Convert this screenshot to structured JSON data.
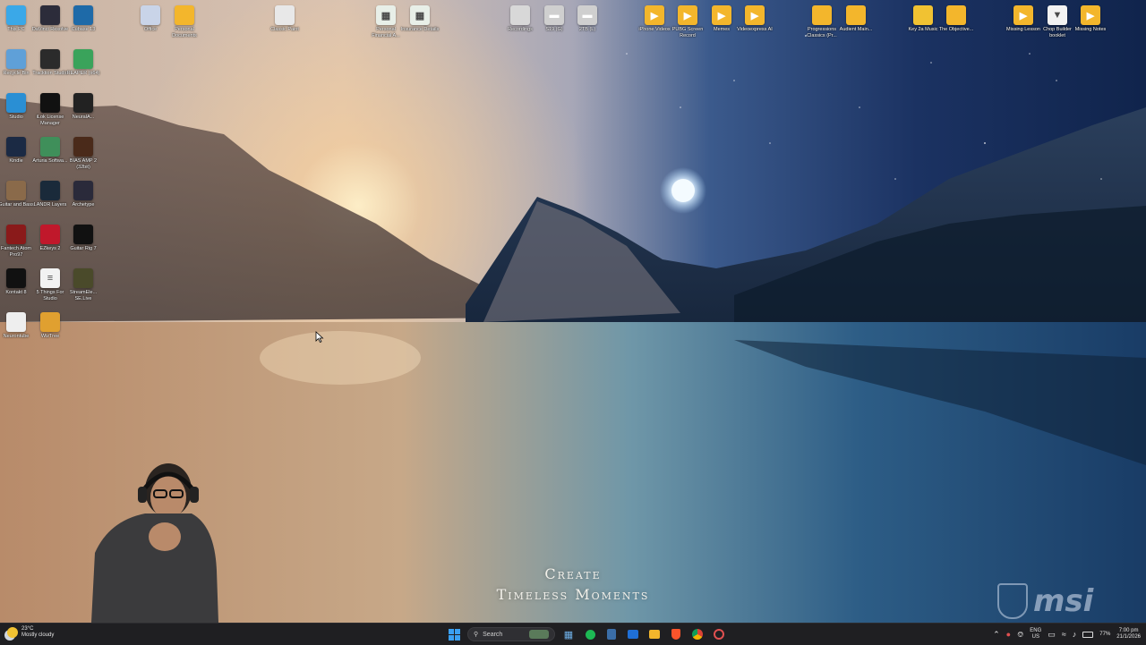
{
  "desktop_icons": [
    {
      "label": "This PC",
      "icon": "pc-icon",
      "color": "#3aa8e8"
    },
    {
      "label": "DaVinci Resolve",
      "icon": "davinci-icon",
      "color": "#2c2c3a"
    },
    {
      "label": "Cubase 13",
      "icon": "cubase-icon",
      "color": "#1e6aa8"
    },
    {
      "label": "Recycle Bin",
      "icon": "recycle-bin-icon",
      "color": "#5fa0d8"
    },
    {
      "label": "Tracktion Studio",
      "icon": "tracktion-icon",
      "color": "#2b2b2b"
    },
    {
      "label": "REAPER (x64)",
      "icon": "reaper-icon",
      "color": "#3aa35b"
    },
    {
      "label": "Studio",
      "icon": "studio-icon",
      "color": "#2a8fd4"
    },
    {
      "label": "iLok License Manager",
      "icon": "ilok-icon",
      "color": "#111111"
    },
    {
      "label": "NeuralA...",
      "icon": "neural-icon",
      "color": "#222222"
    },
    {
      "label": "Kindle",
      "icon": "kindle-icon",
      "color": "#1b2a44"
    },
    {
      "label": "Arturia Softwa...",
      "icon": "arturia-icon",
      "color": "#3f8f5a"
    },
    {
      "label": "BIAS AMP 2 (32bit)",
      "icon": "bias-amp-icon",
      "color": "#4a2a1a"
    },
    {
      "label": "Guitar and Bass",
      "icon": "guitar-icon",
      "color": "#8a6a4a"
    },
    {
      "label": "LANDR Layers",
      "icon": "landr-icon",
      "color": "#1a2a3a"
    },
    {
      "label": "Archetype",
      "icon": "archetype-icon",
      "color": "#2a2a3a"
    },
    {
      "label": "Fantech Atom Pro97",
      "icon": "fantech-icon",
      "color": "#8a1a1a"
    },
    {
      "label": "EZkeys 2",
      "icon": "ezkeys-icon",
      "color": "#c0182b"
    },
    {
      "label": "Guitar Rig 7",
      "icon": "guitar-rig-icon",
      "color": "#111111"
    },
    {
      "label": "Kontakt 8",
      "icon": "kontakt-icon",
      "color": "#111111"
    },
    {
      "label": "5 Things For Studio",
      "icon": "text-file-icon",
      "color": "#f2f2f2"
    },
    {
      "label": "StreamEle... SE.Live",
      "icon": "streamelements-icon",
      "color": "#4a4a2a"
    },
    {
      "label": "Neurontube",
      "icon": "neurontube-icon",
      "color": "#eeeeee"
    },
    {
      "label": "WizTree",
      "icon": "wiztree-icon",
      "color": "#e0a030"
    },
    {
      "label": "Office",
      "icon": "office-icon",
      "color": "#c9d4e8"
    },
    {
      "label": "Personal Documents",
      "icon": "folder-icon",
      "color": "#f3b62c"
    },
    {
      "label": "Classic Paint",
      "icon": "paint-icon",
      "color": "#e8e8e8"
    },
    {
      "label": "Personal Financial A...",
      "icon": "spreadsheet-icon",
      "color": "#e8efe8"
    },
    {
      "label": "Insurance Details",
      "icon": "spreadsheet-icon",
      "color": "#e8efe8"
    },
    {
      "label": "Recordings",
      "icon": "recordings-icon",
      "color": "#d8d8d8"
    },
    {
      "label": "S19 (G)",
      "icon": "drive-icon",
      "color": "#cfcfcf"
    },
    {
      "label": "2TB (L)",
      "icon": "drive-icon",
      "color": "#cfcfcf"
    },
    {
      "label": "iPhone Videos",
      "icon": "video-folder-icon",
      "color": "#f3b62c"
    },
    {
      "label": "PUBG Screen Record",
      "icon": "video-folder-icon",
      "color": "#f3b62c"
    },
    {
      "label": "Memes",
      "icon": "video-folder-icon",
      "color": "#f3b62c"
    },
    {
      "label": "Videoexpress AI",
      "icon": "video-folder-icon",
      "color": "#f3b62c"
    },
    {
      "label": "Progressions Classics (Pr...",
      "icon": "folder-icon",
      "color": "#f3b62c"
    },
    {
      "label": "Audient Main...",
      "icon": "folder-icon",
      "color": "#f3b62c"
    },
    {
      "label": "Key 2a Music",
      "icon": "chrome-icon",
      "color": "#f1c232"
    },
    {
      "label": "The Objective...",
      "icon": "folder-icon",
      "color": "#f3b62c"
    },
    {
      "label": "Missing Lesson",
      "icon": "video-folder-icon",
      "color": "#f3b62c"
    },
    {
      "label": "Chop Builder booklet",
      "icon": "pdf-icon",
      "color": "#f2f2f2"
    },
    {
      "label": "Missing Notes",
      "icon": "video-folder-icon",
      "color": "#f3b62c"
    }
  ],
  "wallpaper": {
    "tagline_line1": "Create",
    "tagline_line2": "Timeless Moments",
    "brand": "msi"
  },
  "taskbar": {
    "weather_temp": "23°C",
    "weather_desc": "Mostly cloudy",
    "search_placeholder": "Search",
    "apps": [
      "file-explorer-icon",
      "spotify-icon",
      "calculator-icon",
      "mail-icon",
      "folder-icon",
      "brave-icon",
      "chrome-icon",
      "davinci-icon"
    ],
    "lang_top": "ENG",
    "lang_bottom": "US",
    "battery": "77%",
    "time": "7:00 pm",
    "date": "21/1/2026"
  },
  "accent": "#3aa0f3"
}
